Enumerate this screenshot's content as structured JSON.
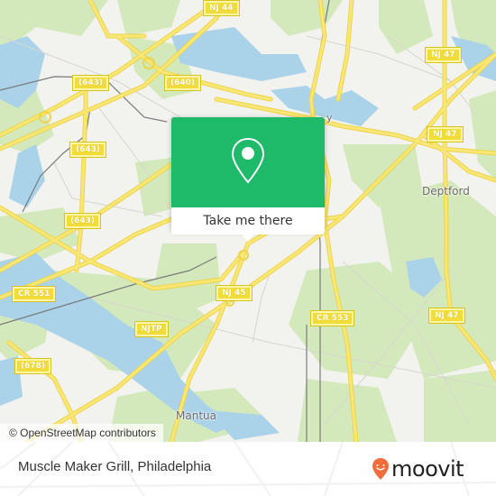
{
  "map": {
    "road_shields": [
      {
        "label": "NJ 44",
        "id": "nj44"
      },
      {
        "label": "(643)",
        "id": "cr643-a"
      },
      {
        "label": "(640)",
        "id": "cr640"
      },
      {
        "label": "NJ 47",
        "id": "nj47-a"
      },
      {
        "label": "NJ 47",
        "id": "nj47-b"
      },
      {
        "label": "(643)",
        "id": "cr643-b"
      },
      {
        "label": "(643)",
        "id": "cr643-c"
      },
      {
        "label": "CR 551",
        "id": "cr551"
      },
      {
        "label": "NJ 45",
        "id": "nj45"
      },
      {
        "label": "NJTP",
        "id": "njtp"
      },
      {
        "label": "CR 553",
        "id": "cr553"
      },
      {
        "label": "NJ 47",
        "id": "nj47-c"
      },
      {
        "label": "(678)",
        "id": "cr678"
      }
    ],
    "places": [
      {
        "label": "Deptford",
        "id": "deptford"
      },
      {
        "label": "Mantua",
        "id": "mantua"
      },
      {
        "label": "y",
        "id": "woodbury-fragment"
      }
    ],
    "attribution": "© OpenStreetMap contributors",
    "colors": {
      "land": "#f2f2ee",
      "park": "#cfe8b3",
      "water": "#a8d4ec",
      "road": "#f7e26b",
      "rail": "#777777"
    }
  },
  "popup": {
    "pin_icon": "map-pin-icon",
    "action_label": "Take me there",
    "color": "#1fb96a"
  },
  "footer": {
    "place_title": "Muscle Maker Grill, Philadelphia",
    "brand": "moovit",
    "brand_icon_color": "#f26b3a"
  }
}
